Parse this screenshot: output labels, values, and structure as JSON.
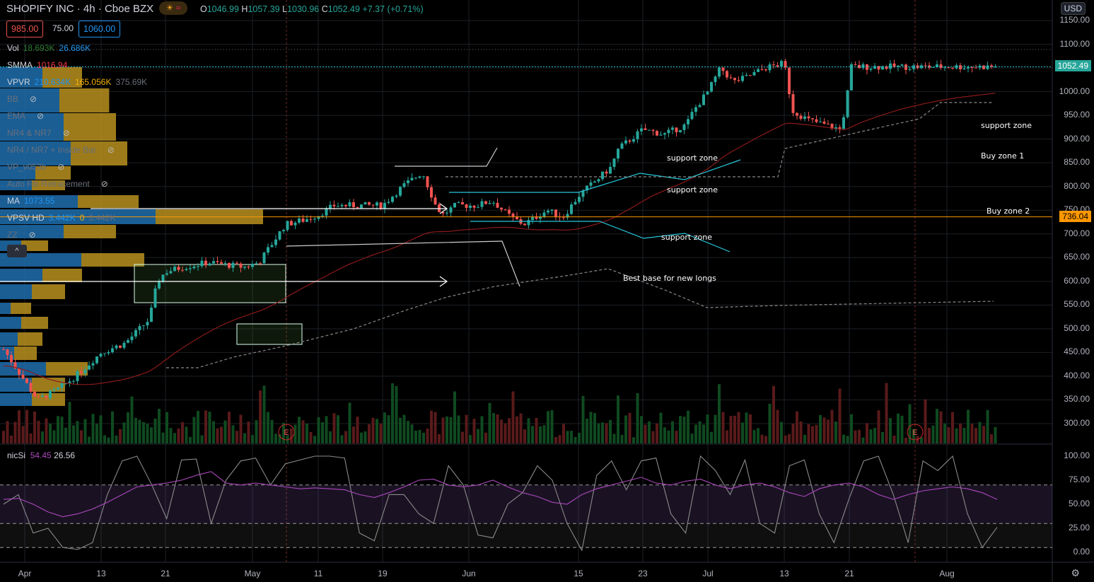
{
  "header": {
    "symbol": "SHOPIFY INC",
    "interval": "4h",
    "exchange": "Cboe BZX",
    "ohlc": {
      "o_label": "O",
      "o": "1046.99",
      "h_label": "H",
      "h": "1057.39",
      "l_label": "L",
      "l": "1030.96",
      "c_label": "C",
      "c": "1052.49",
      "change": "+7.37 (+0.71%)"
    },
    "badge_icons": [
      "sun-icon",
      "wave-icon"
    ],
    "currency": "USD"
  },
  "price_boxes": {
    "sell": "985.00",
    "spread": "75.00",
    "buy": "1060.00"
  },
  "legend": [
    {
      "name": "Vol",
      "v1": "18.693K",
      "v2": "26.686K",
      "hidden": false
    },
    {
      "name": "SMMA",
      "v1": "1016.94",
      "hidden": false
    },
    {
      "name": "VPVR",
      "v1": "210.634K",
      "v2": "165.056K",
      "v3": "375.69K",
      "hidden": false
    },
    {
      "name": "BB",
      "hidden": true
    },
    {
      "name": "EMA",
      "hidden": true
    },
    {
      "name": "NR4 & NR7",
      "hidden": true
    },
    {
      "name": "NR4 / NR7 + Inside Bar",
      "hidden": true
    },
    {
      "name": "VP_v053b",
      "hidden": true
    },
    {
      "name": "Auto Fib Retracement",
      "hidden": true
    },
    {
      "name": "MA",
      "v1": "1073.55",
      "hidden": false
    },
    {
      "name": "VPSV HD",
      "v1": "3.442K",
      "v2": "0",
      "v3": "3.442K",
      "hidden": false
    },
    {
      "name": "ZZ",
      "hidden": true
    }
  ],
  "annotations": [
    "support zone",
    "support zone",
    "support zone",
    "Best base for new longs",
    "support zone",
    "Buy zone 1",
    "Buy zone 2"
  ],
  "earnings_marker": "E",
  "colors": {
    "up": "#26a69a",
    "down": "#ef5350",
    "rsi": "#ab47bc",
    "price_tag": "#26a69a",
    "level_tag": "#ff9800",
    "vp_up": "#1e6fae",
    "vp_down": "#b8901e"
  },
  "chart_data": {
    "type": "candlestick",
    "y_ticks": [
      "1150.00",
      "1100.00",
      "1050.00",
      "1000.00",
      "950.00",
      "900.00",
      "850.00",
      "800.00",
      "750.00",
      "700.00",
      "650.00",
      "600.00",
      "550.00",
      "500.00",
      "450.00",
      "400.00",
      "350.00",
      "300.00"
    ],
    "ylim": [
      300,
      1150
    ],
    "x_ticks": [
      "Apr",
      "13",
      "21",
      "May",
      "11",
      "19",
      "Jun",
      "15",
      "23",
      "Jul",
      "13",
      "21",
      "Aug"
    ],
    "last_price": "1052.49",
    "level_price": "736.04",
    "closes": [
      [
        "03-30",
        430
      ],
      [
        "04-01",
        390
      ],
      [
        "04-03",
        350
      ],
      [
        "04-06",
        370
      ],
      [
        "04-09",
        400
      ],
      [
        "04-13",
        450
      ],
      [
        "04-16",
        470
      ],
      [
        "04-19",
        520
      ],
      [
        "04-20",
        600
      ],
      [
        "04-21",
        620
      ],
      [
        "04-23",
        630
      ],
      [
        "04-26",
        640
      ],
      [
        "04-30",
        630
      ],
      [
        "05-02",
        640
      ],
      [
        "05-04",
        680
      ],
      [
        "05-06",
        720
      ],
      [
        "05-09",
        730
      ],
      [
        "05-11",
        740
      ],
      [
        "05-13",
        760
      ],
      [
        "05-15",
        760
      ],
      [
        "05-19",
        760
      ],
      [
        "05-22",
        800
      ],
      [
        "05-25",
        830
      ],
      [
        "05-27",
        760
      ],
      [
        "05-28",
        740
      ],
      [
        "05-30",
        760
      ],
      [
        "06-02",
        760
      ],
      [
        "06-04",
        770
      ],
      [
        "06-06",
        740
      ],
      [
        "06-08",
        720
      ],
      [
        "06-11",
        750
      ],
      [
        "06-13",
        735
      ],
      [
        "06-15",
        780
      ],
      [
        "06-17",
        810
      ],
      [
        "06-19",
        840
      ],
      [
        "06-20",
        880
      ],
      [
        "06-23",
        920
      ],
      [
        "06-26",
        910
      ],
      [
        "06-29",
        930
      ],
      [
        "06-30",
        960
      ],
      [
        "07-01",
        1000
      ],
      [
        "07-03",
        1050
      ],
      [
        "07-05",
        1020
      ],
      [
        "07-07",
        1030
      ],
      [
        "07-10",
        1050
      ],
      [
        "07-13",
        1060
      ],
      [
        "07-14",
        960
      ],
      [
        "07-16",
        940
      ],
      [
        "07-18",
        930
      ],
      [
        "07-20",
        920
      ],
      [
        "07-21",
        1020
      ],
      [
        "07-22",
        960
      ],
      [
        "07-24",
        950
      ],
      [
        "07-26",
        910
      ],
      [
        "07-27",
        960
      ],
      [
        "07-29",
        990
      ],
      [
        "07-30",
        1090
      ],
      [
        "07-31",
        1060
      ],
      [
        "08-02",
        1040
      ],
      [
        "08-03",
        1060
      ],
      [
        "08-05",
        1090
      ],
      [
        "08-07",
        1095
      ],
      [
        "08-08",
        1090
      ],
      [
        "08-09",
        1040
      ],
      [
        "08-10",
        1052.49
      ]
    ],
    "volume_axis": "hidden",
    "rsi": {
      "name": "nicSi",
      "v1": "54.45",
      "v2": "26.56",
      "y_ticks": [
        "100.00",
        "75.00",
        "50.00",
        "25.00",
        "0.00"
      ],
      "bands": [
        70,
        30,
        5
      ],
      "smooth": [
        55,
        56,
        50,
        42,
        37,
        40,
        45,
        52,
        60,
        68,
        70,
        72,
        75,
        80,
        84,
        72,
        70,
        72,
        70,
        68,
        66,
        67,
        66,
        65,
        60,
        57,
        62,
        68,
        75,
        76,
        70,
        68,
        70,
        75,
        68,
        62,
        58,
        52,
        50,
        60,
        66,
        70,
        74,
        78,
        72,
        70,
        74,
        76,
        70,
        66,
        70,
        72,
        68,
        62,
        58,
        66,
        70,
        72,
        68,
        60,
        55,
        60,
        64,
        66,
        68,
        66,
        62,
        55
      ],
      "fast": [
        50,
        60,
        20,
        25,
        5,
        3,
        10,
        60,
        95,
        100,
        70,
        35,
        96,
        97,
        30,
        75,
        95,
        98,
        70,
        92,
        96,
        100,
        100,
        98,
        20,
        12,
        60,
        60,
        40,
        30,
        90,
        70,
        18,
        15,
        50,
        62,
        90,
        75,
        30,
        2,
        80,
        95,
        65,
        95,
        98,
        40,
        20,
        100,
        85,
        60,
        96,
        30,
        20,
        90,
        96,
        40,
        10,
        55,
        95,
        100,
        60,
        10,
        95,
        85,
        100,
        40,
        5,
        26
      ]
    }
  }
}
